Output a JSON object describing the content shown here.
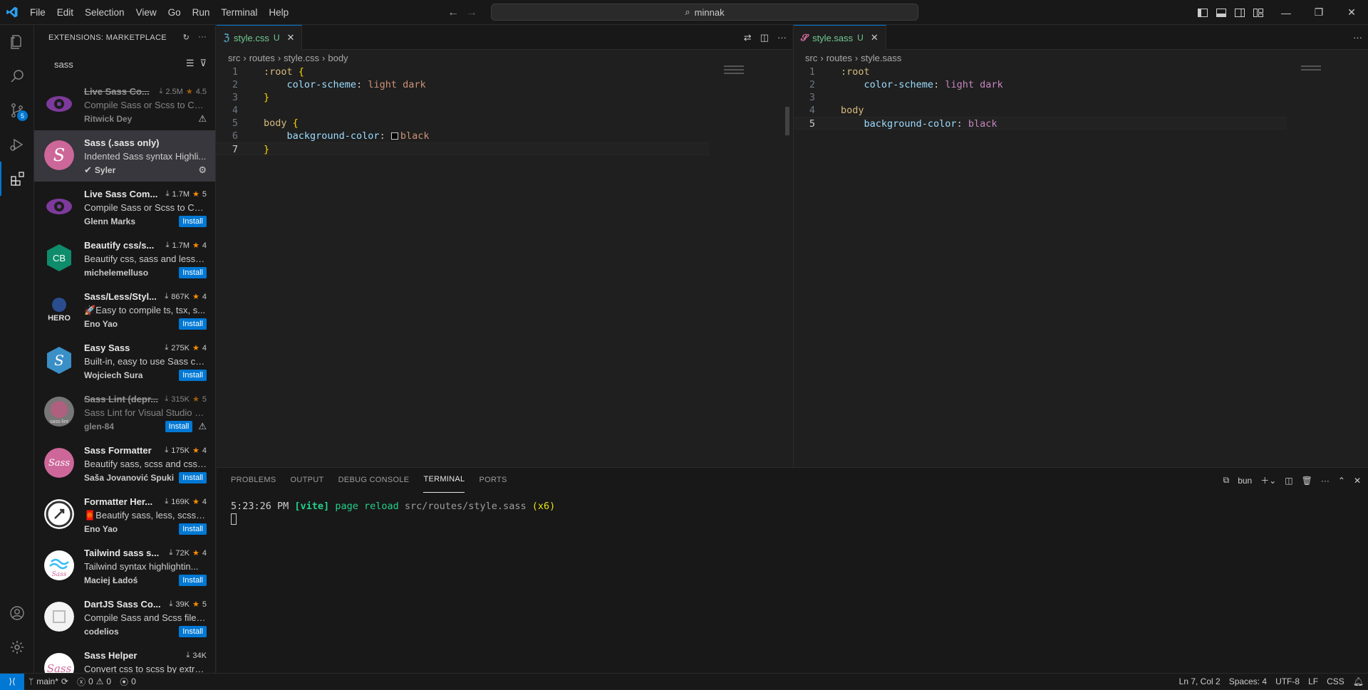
{
  "menu": [
    "File",
    "Edit",
    "Selection",
    "View",
    "Go",
    "Run",
    "Terminal",
    "Help"
  ],
  "command_center": {
    "text": "minnak"
  },
  "activity": {
    "source_control_badge": "5"
  },
  "sidebar": {
    "title": "EXTENSIONS: MARKETPLACE",
    "search_value": "sass",
    "extensions": [
      {
        "name": "Live Sass Co...",
        "installs": "2.5M",
        "rating": "4.5",
        "desc": "Compile Sass or Scss to CS...",
        "publisher": "Ritwick Dey",
        "install": "",
        "deprecated": true,
        "warn": true,
        "icon": "eye-icon"
      },
      {
        "name": "Sass (.sass only)",
        "installs": "",
        "rating": "",
        "desc": "Indented Sass syntax Highli...",
        "publisher": "Syler",
        "install": "",
        "deprecated": false,
        "selected": true,
        "icon": "sass-logo-icon"
      },
      {
        "name": "Live Sass Com...",
        "installs": "1.7M",
        "rating": "5",
        "desc": "Compile Sass or Scss to CS...",
        "publisher": "Glenn Marks",
        "install": "Install",
        "icon": "eye-icon"
      },
      {
        "name": "Beautify css/s...",
        "installs": "1.7M",
        "rating": "4",
        "desc": "Beautify css, sass and less c...",
        "publisher": "michelemelluso",
        "install": "Install",
        "icon": "cb-icon"
      },
      {
        "name": "Sass/Less/Styl...",
        "installs": "867K",
        "rating": "4",
        "desc": "🚀Easy to compile ts, tsx, s...",
        "publisher": "Eno Yao",
        "install": "Install",
        "icon": "hero-icon"
      },
      {
        "name": "Easy Sass",
        "installs": "275K",
        "rating": "4",
        "desc": "Built-in, easy to use Sass co...",
        "publisher": "Wojciech Sura",
        "install": "Install",
        "icon": "easy-sass-icon"
      },
      {
        "name": "Sass Lint (depr...",
        "installs": "315K",
        "rating": "5",
        "desc": "Sass Lint for Visual Studio C...",
        "publisher": "glen-84",
        "install": "Install",
        "deprecated": true,
        "warn": true,
        "icon": "sass-lint-icon"
      },
      {
        "name": "Sass Formatter",
        "installs": "175K",
        "rating": "4",
        "desc": "Beautify sass, scss and css ...",
        "publisher": "Saša Jovanović Spuki",
        "install": "Install",
        "icon": "sass-formatter-icon"
      },
      {
        "name": "Formatter Her...",
        "installs": "169K",
        "rating": "4",
        "desc": "🧧Beautify sass, less, scss, ...",
        "publisher": "Eno Yao",
        "install": "Install",
        "icon": "rocket-icon"
      },
      {
        "name": "Tailwind sass s...",
        "installs": "72K",
        "rating": "4",
        "desc": "Tailwind syntax highlightin...",
        "publisher": "Maciej Ładoś",
        "install": "Install",
        "icon": "tailwind-sass-icon"
      },
      {
        "name": "DartJS Sass Co...",
        "installs": "39K",
        "rating": "5",
        "desc": "Compile Sass and Scss files...",
        "publisher": "codelios",
        "install": "Install",
        "icon": "dartjs-icon"
      },
      {
        "name": "Sass Helper",
        "installs": "34K",
        "rating": "",
        "desc": "Convert css to scss by extra...",
        "publisher": "",
        "install": "",
        "icon": "sass-helper-icon"
      }
    ]
  },
  "editor_left": {
    "tab": {
      "name": "style.css",
      "status": "U"
    },
    "breadcrumb": [
      "src",
      "routes",
      "style.css",
      "body"
    ],
    "lines": [
      [
        {
          "t": ":root",
          "c": "k-sel"
        },
        {
          "t": " ",
          "c": ""
        },
        {
          "t": "{",
          "c": "k-brace"
        }
      ],
      [
        {
          "t": "    ",
          "c": ""
        },
        {
          "t": "color-scheme",
          "c": "k-prop"
        },
        {
          "t": ": ",
          "c": "k-punc"
        },
        {
          "t": "light dark",
          "c": "k-val"
        }
      ],
      [
        {
          "t": "}",
          "c": "k-brace"
        }
      ],
      [],
      [
        {
          "t": "body",
          "c": "k-tag"
        },
        {
          "t": " ",
          "c": ""
        },
        {
          "t": "{",
          "c": "k-brace"
        }
      ],
      [
        {
          "t": "    ",
          "c": ""
        },
        {
          "t": "background-color",
          "c": "k-prop"
        },
        {
          "t": ": ",
          "c": "k-punc"
        },
        {
          "t": "SWATCH",
          "c": "swatch"
        },
        {
          "t": "black",
          "c": "k-val"
        }
      ],
      [
        {
          "t": "}",
          "c": "k-brace"
        }
      ]
    ],
    "current_line": 7
  },
  "editor_right": {
    "tab": {
      "name": "style.sass",
      "status": "U"
    },
    "breadcrumb": [
      "src",
      "routes",
      "style.sass"
    ],
    "lines": [
      [
        {
          "t": ":root",
          "c": "k-sel"
        }
      ],
      [
        {
          "t": "    ",
          "c": ""
        },
        {
          "t": "color-scheme",
          "c": "k-prop"
        },
        {
          "t": ": ",
          "c": "k-punc"
        },
        {
          "t": "light dark",
          "c": "k-sassval"
        }
      ],
      [],
      [
        {
          "t": "body",
          "c": "k-tag"
        }
      ],
      [
        {
          "t": "    ",
          "c": ""
        },
        {
          "t": "background-color",
          "c": "k-prop"
        },
        {
          "t": ": ",
          "c": "k-punc"
        },
        {
          "t": "black",
          "c": "k-sassval"
        }
      ]
    ],
    "current_line": 5
  },
  "panel": {
    "tabs": [
      "PROBLEMS",
      "OUTPUT",
      "DEBUG CONSOLE",
      "TERMINAL",
      "PORTS"
    ],
    "active_tab": "TERMINAL",
    "shell": "bun",
    "terminal": {
      "time": "5:23:26 PM",
      "tag": "[vite]",
      "msg": "page reload",
      "path": "src/routes/style.sass",
      "count": "(x6)"
    }
  },
  "status": {
    "branch": "main*",
    "errors": "0",
    "warnings": "0",
    "ports": "0",
    "position": "Ln 7, Col 2",
    "spaces": "Spaces: 4",
    "encoding": "UTF-8",
    "eol": "LF",
    "language": "CSS"
  },
  "colors": {
    "accent": "#0078d4",
    "added": "#73c991",
    "star": "#ff8e00"
  }
}
